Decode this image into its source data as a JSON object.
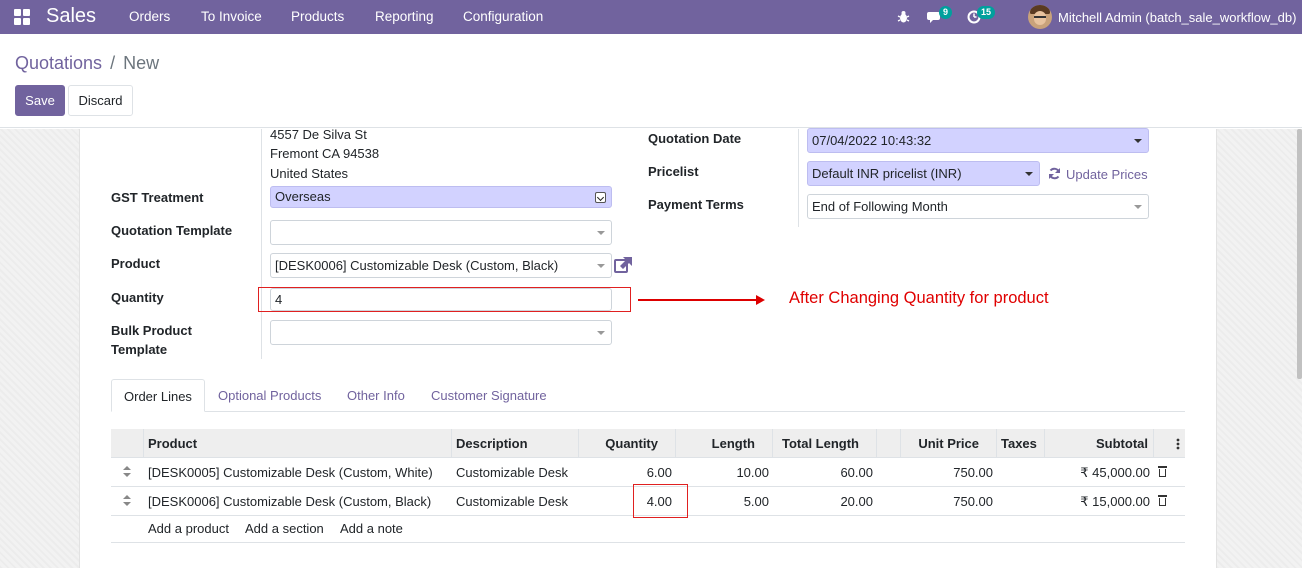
{
  "navbar": {
    "app_name": "Sales",
    "menu": [
      "Orders",
      "To Invoice",
      "Products",
      "Reporting",
      "Configuration"
    ],
    "messages_badge": "9",
    "activities_badge": "15",
    "user": "Mitchell Admin (batch_sale_workflow_db)"
  },
  "breadcrumb": {
    "parent": "Quotations",
    "separator": "/",
    "current": "New"
  },
  "buttons": {
    "save": "Save",
    "discard": "Discard"
  },
  "address": [
    "4557 De Silva St",
    "Fremont CA 94538",
    "United States"
  ],
  "form": {
    "gst_treatment": {
      "label": "GST Treatment",
      "value": "Overseas"
    },
    "quotation_template": {
      "label": "Quotation Template",
      "value": ""
    },
    "product": {
      "label": "Product",
      "value": "[DESK0006] Customizable Desk (Custom, Black)"
    },
    "quantity": {
      "label": "Quantity",
      "value": "4"
    },
    "bulk_template": {
      "label_line1": "Bulk Product",
      "label_line2": "Template",
      "value": ""
    },
    "quotation_date": {
      "label": "Quotation Date",
      "value": "07/04/2022 10:43:32"
    },
    "pricelist": {
      "label": "Pricelist",
      "value": "Default INR pricelist (INR)"
    },
    "update_prices": "Update Prices",
    "payment_terms": {
      "label": "Payment Terms",
      "value": "End of Following Month"
    }
  },
  "annotation": "After Changing Quantity for product",
  "tabs": [
    "Order Lines",
    "Optional Products",
    "Other Info",
    "Customer Signature"
  ],
  "table": {
    "headers": [
      "Product",
      "Description",
      "Quantity",
      "Length",
      "Total Length",
      "Unit Price",
      "Taxes",
      "Subtotal"
    ],
    "rows": [
      {
        "product": "[DESK0005] Customizable Desk (Custom, White)",
        "description": "Customizable Desk",
        "quantity": "6.00",
        "length": "10.00",
        "total_length": "60.00",
        "unit_price": "750.00",
        "taxes": "",
        "subtotal": "₹ 45,000.00"
      },
      {
        "product": "[DESK0006] Customizable Desk (Custom, Black)",
        "description": "Customizable Desk",
        "quantity": "4.00",
        "length": "5.00",
        "total_length": "20.00",
        "unit_price": "750.00",
        "taxes": "",
        "subtotal": "₹ 15,000.00"
      }
    ],
    "add_links": [
      "Add a product",
      "Add a section",
      "Add a note"
    ]
  },
  "colors": {
    "brand": "#71639e",
    "required_field": "#d2d2ff",
    "annotation": "#e00000",
    "badge": "#00a09d"
  }
}
